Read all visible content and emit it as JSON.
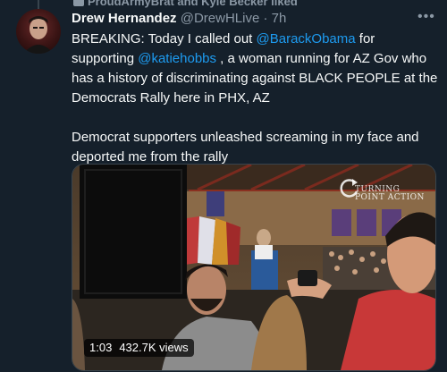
{
  "context": {
    "label": "ProudArmyBrat and Kyle Becker liked",
    "icon": "heart-icon"
  },
  "author": {
    "name": "Drew Hernandez",
    "handle": "@DrewHLive",
    "separator": "·",
    "time": "7h"
  },
  "tweet": {
    "p1_a": "BREAKING: Today I called out ",
    "mention1": "@BarackObama",
    "p1_b": " for supporting ",
    "mention2": "@katiehobbs",
    "p1_c": " , a woman running for AZ Gov who has a history of discriminating against BLACK PEOPLE at the Democrats Rally here in PHX, AZ",
    "p2": "Democrat supporters unleashed screaming in my face and deported me from the rally"
  },
  "media": {
    "duration": "1:03",
    "views": "432.7K views",
    "watermark_line1": "TURNING",
    "watermark_line2": "POINT ACTION"
  },
  "icons": {
    "more": "more-icon"
  },
  "colors": {
    "background": "#15202b",
    "text": "#f7f9f9",
    "secondary": "#8b98a5",
    "link": "#1d9bf0"
  }
}
